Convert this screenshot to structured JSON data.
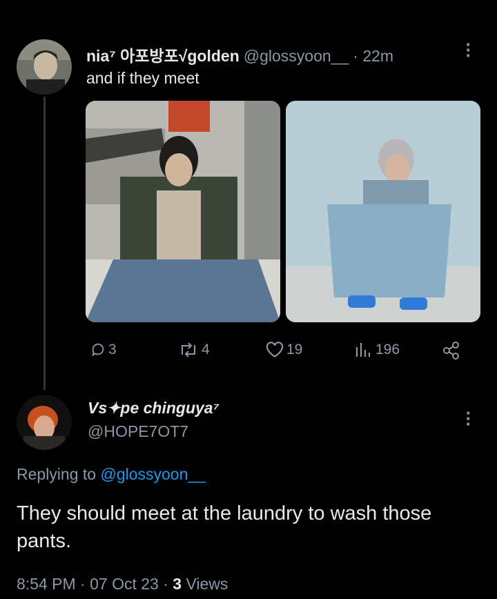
{
  "tweet1": {
    "display_name": "nia⁷ 아포방포√golden",
    "handle": "@glossyoon__",
    "time": "· 22m",
    "text": "and if they meet",
    "actions": {
      "replies": "3",
      "retweets": "4",
      "likes": "19",
      "views": "196"
    }
  },
  "tweet2": {
    "display_name": "Vs✦pe chinguya⁷",
    "handle": "@HOPE7OT7",
    "replying_prefix": "Replying to",
    "replying_to": "@glossyoon__",
    "text": "They should meet at the laundry to wash those pants.",
    "timestamp": "8:54 PM · 07 Oct 23 · ",
    "views_count": "3",
    "views_label": " Views"
  },
  "colors": {
    "background": "#000000",
    "text": "#e7e9ea",
    "secondary": "#8b98a5",
    "link": "#1d9bf0",
    "divider": "#333639"
  }
}
